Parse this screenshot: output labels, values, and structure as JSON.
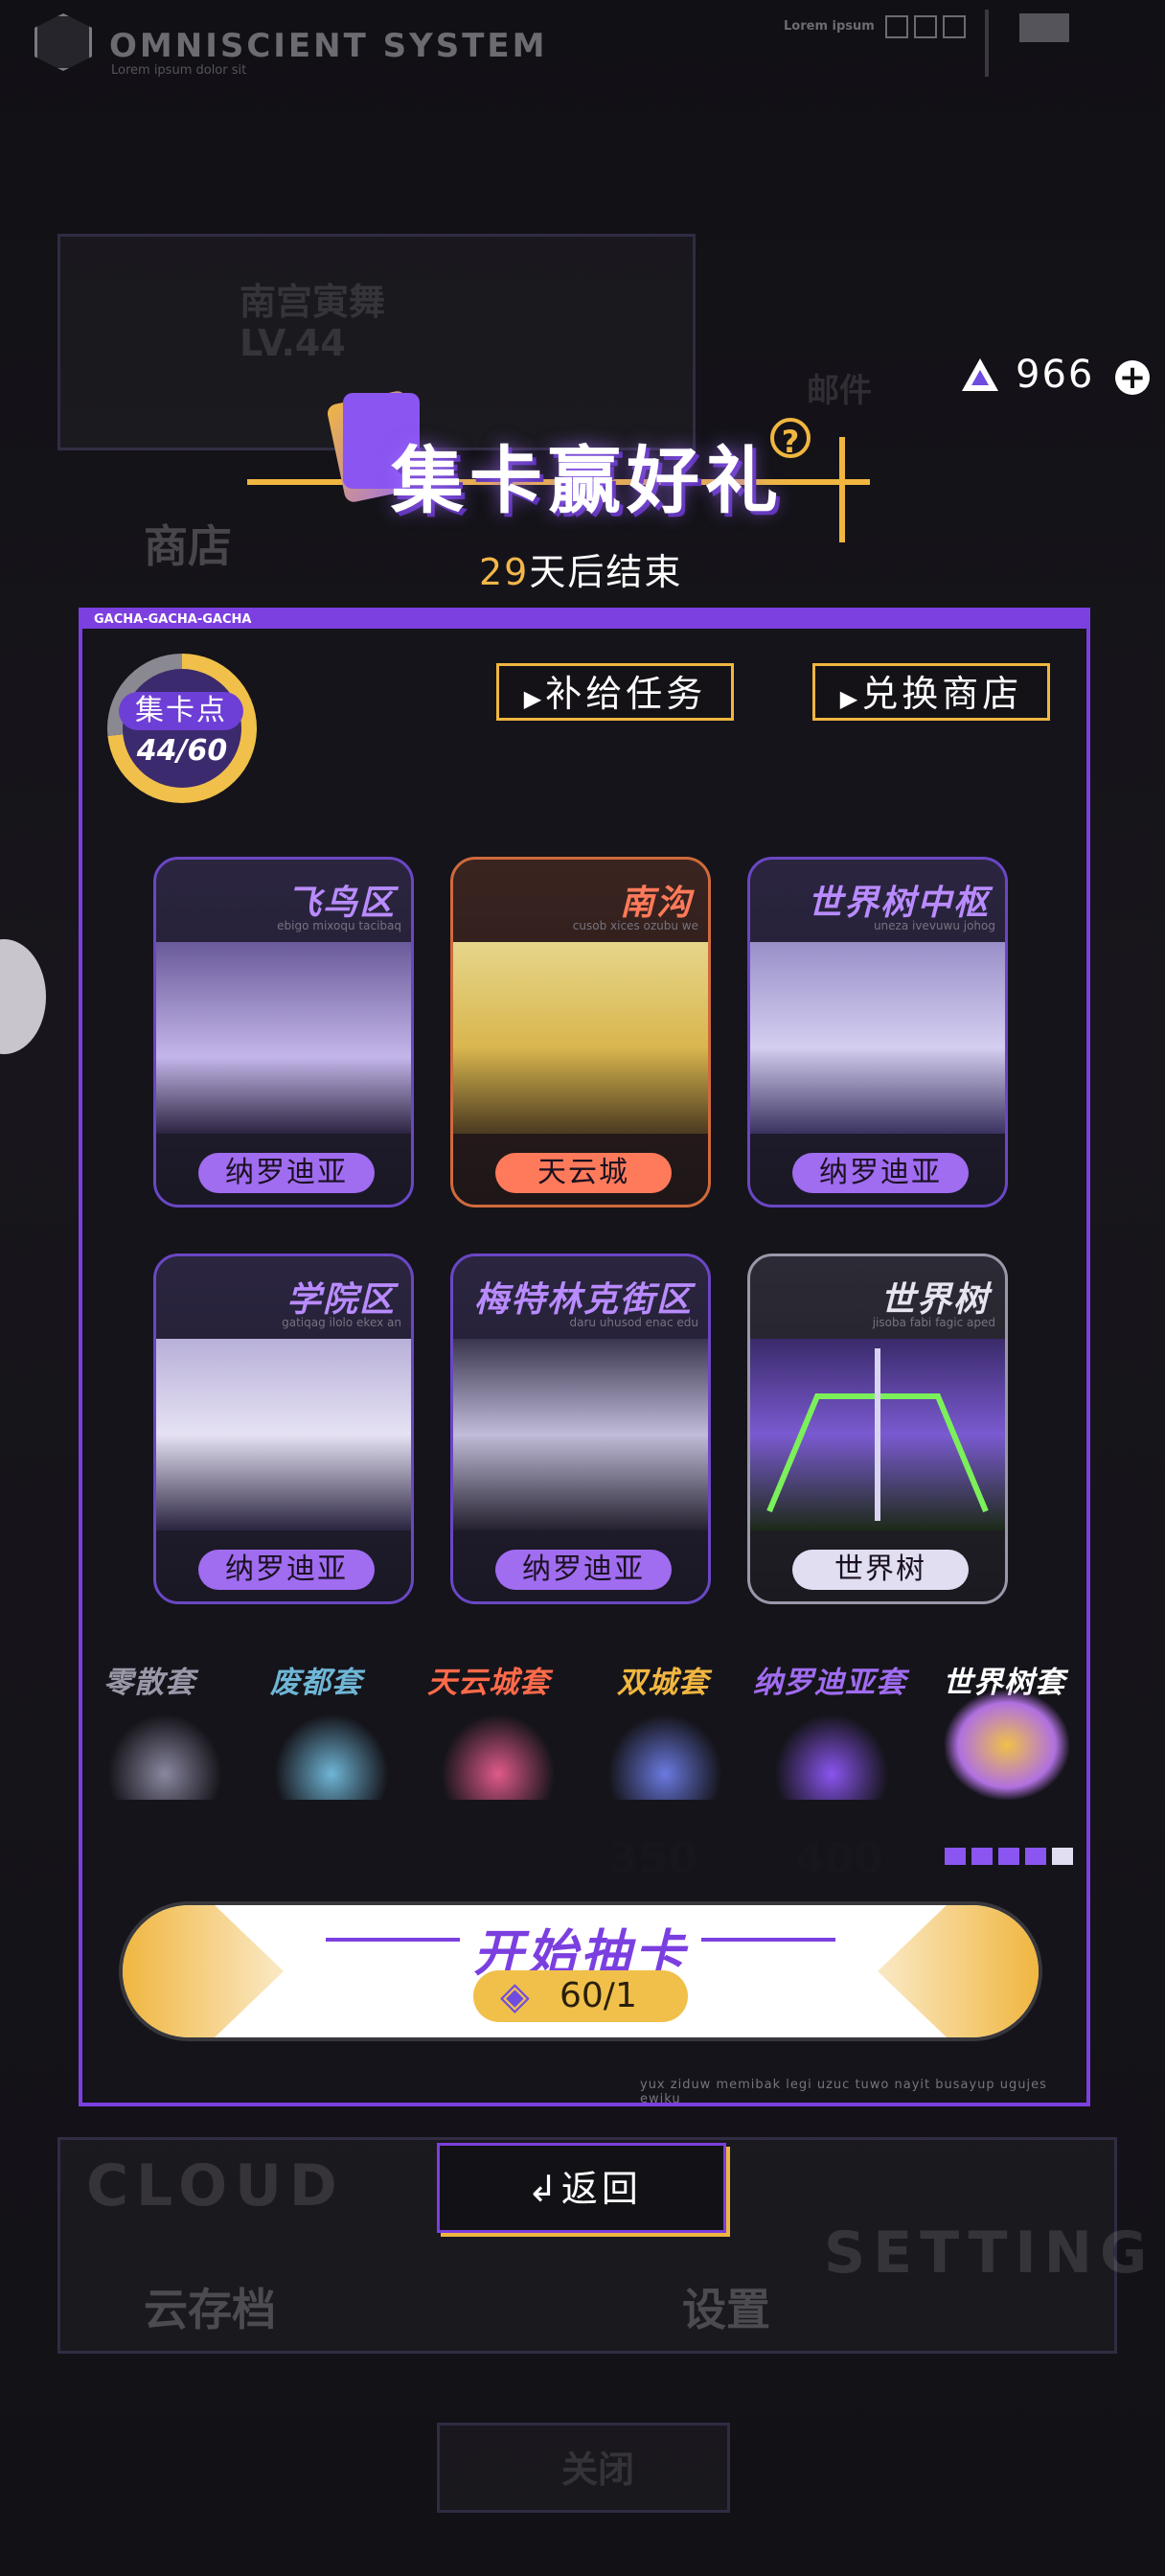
{
  "header": {
    "brand_title": "OMNISCIENT SYSTEM",
    "brand_subtitle": "Lorem ipsum dolor sit",
    "top_right_label": "Lorem ipsum"
  },
  "currency": {
    "amount": "966"
  },
  "background": {
    "player_name": "南宫寅舞",
    "player_level": "LV.44",
    "mail_label": "邮件",
    "shop_label": "商店",
    "cloud_label": "CLOUD",
    "cloud_save_label": "云存档",
    "setting_en": "SETTING",
    "settings_label": "设置",
    "close_label": "关闭",
    "ghost_numbers": [
      "350",
      "400"
    ]
  },
  "event": {
    "title": "集卡赢好礼",
    "help": "?",
    "days_left": "29",
    "days_suffix": "天后结束"
  },
  "panel": {
    "tag": "GACHA-GACHA-GACHA",
    "points_label": "集卡点",
    "points_value": "44/60",
    "supply_task_button": "补给任务",
    "exchange_shop_button": "兑换商店",
    "footnote": "yux ziduw memibak legi uzuc tuwo nayit busayup ugujes ewiku"
  },
  "cards": [
    {
      "name": "飞鸟区",
      "sub": "ebigo mixoqu tacibaq",
      "badge": "纳罗迪亚"
    },
    {
      "name": "南沟",
      "sub": "cusob xices ozubu we",
      "badge": "天云城"
    },
    {
      "name": "世界树中枢",
      "sub": "uneza ivevuwu johog",
      "badge": "纳罗迪亚"
    },
    {
      "name": "学院区",
      "sub": "gatiqag ilolo ekex an",
      "badge": "纳罗迪亚"
    },
    {
      "name": "梅特林克街区",
      "sub": "daru uhusod enac edu",
      "badge": "纳罗迪亚"
    },
    {
      "name": "世界树",
      "sub": "jisoba fabi fagic aped",
      "badge": "世界树"
    }
  ],
  "sets": [
    {
      "name": "零散套",
      "color": "#9a98a8"
    },
    {
      "name": "废都套",
      "color": "#6fb6d6"
    },
    {
      "name": "天云城套",
      "color": "#ff6a4a"
    },
    {
      "name": "双城套",
      "color": "#f0b640"
    },
    {
      "name": "纳罗迪亚套",
      "color": "#a06cf0"
    },
    {
      "name": "世界树套",
      "color": "#ffffff"
    }
  ],
  "set_progress": {
    "filled": 4,
    "total": 5
  },
  "start": {
    "label": "开始抽卡",
    "cost": "60/1"
  },
  "back_button": "返回",
  "colors": {
    "accent_purple": "#7c3fe0",
    "accent_gold": "#f0b640",
    "card_purple": "#a06cf0",
    "card_orange": "#ff7a5a"
  }
}
